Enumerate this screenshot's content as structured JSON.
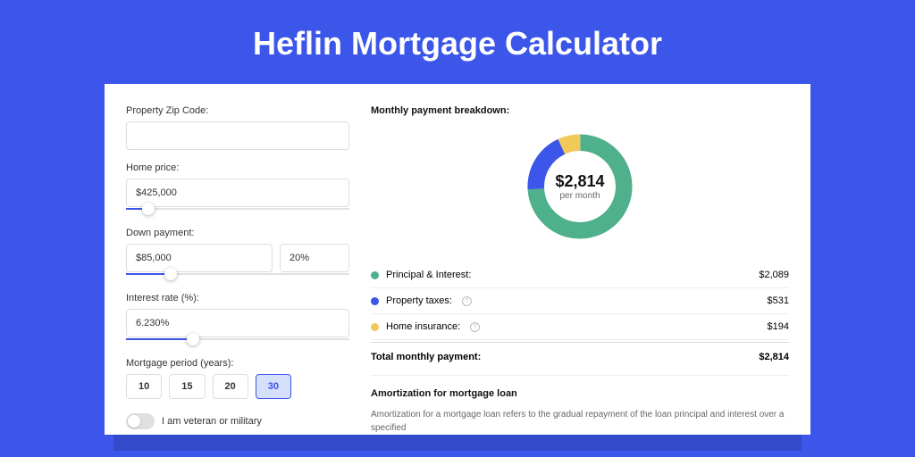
{
  "title": "Heflin Mortgage Calculator",
  "form": {
    "zip_label": "Property Zip Code:",
    "zip_value": "",
    "price_label": "Home price:",
    "price_value": "$425,000",
    "price_slider_pct": 10,
    "down_label": "Down payment:",
    "down_value": "$85,000",
    "down_pct": "20%",
    "down_slider_pct": 20,
    "rate_label": "Interest rate (%):",
    "rate_value": "6.230%",
    "rate_slider_pct": 30,
    "period_label": "Mortgage period (years):",
    "periods": [
      "10",
      "15",
      "20",
      "30"
    ],
    "period_active": "30",
    "veteran_label": "I am veteran or military"
  },
  "breakdown": {
    "title": "Monthly payment breakdown:",
    "center_value": "$2,814",
    "center_label": "per month",
    "items": [
      {
        "label": "Principal & Interest:",
        "value": "$2,089",
        "color": "#4FB08C",
        "info": false,
        "pct": 74
      },
      {
        "label": "Property taxes:",
        "value": "$531",
        "color": "#3B56E8",
        "info": true,
        "pct": 19
      },
      {
        "label": "Home insurance:",
        "value": "$194",
        "color": "#F0C95A",
        "info": true,
        "pct": 7
      }
    ],
    "total_label": "Total monthly payment:",
    "total_value": "$2,814"
  },
  "amortization": {
    "title": "Amortization for mortgage loan",
    "text": "Amortization for a mortgage loan refers to the gradual repayment of the loan principal and interest over a specified"
  },
  "chart_data": {
    "type": "pie",
    "title": "Monthly payment breakdown",
    "series": [
      {
        "name": "Principal & Interest",
        "value": 2089,
        "color": "#4FB08C"
      },
      {
        "name": "Property taxes",
        "value": 531,
        "color": "#3B56E8"
      },
      {
        "name": "Home insurance",
        "value": 194,
        "color": "#F0C95A"
      }
    ],
    "total": 2814,
    "center_label": "per month"
  }
}
